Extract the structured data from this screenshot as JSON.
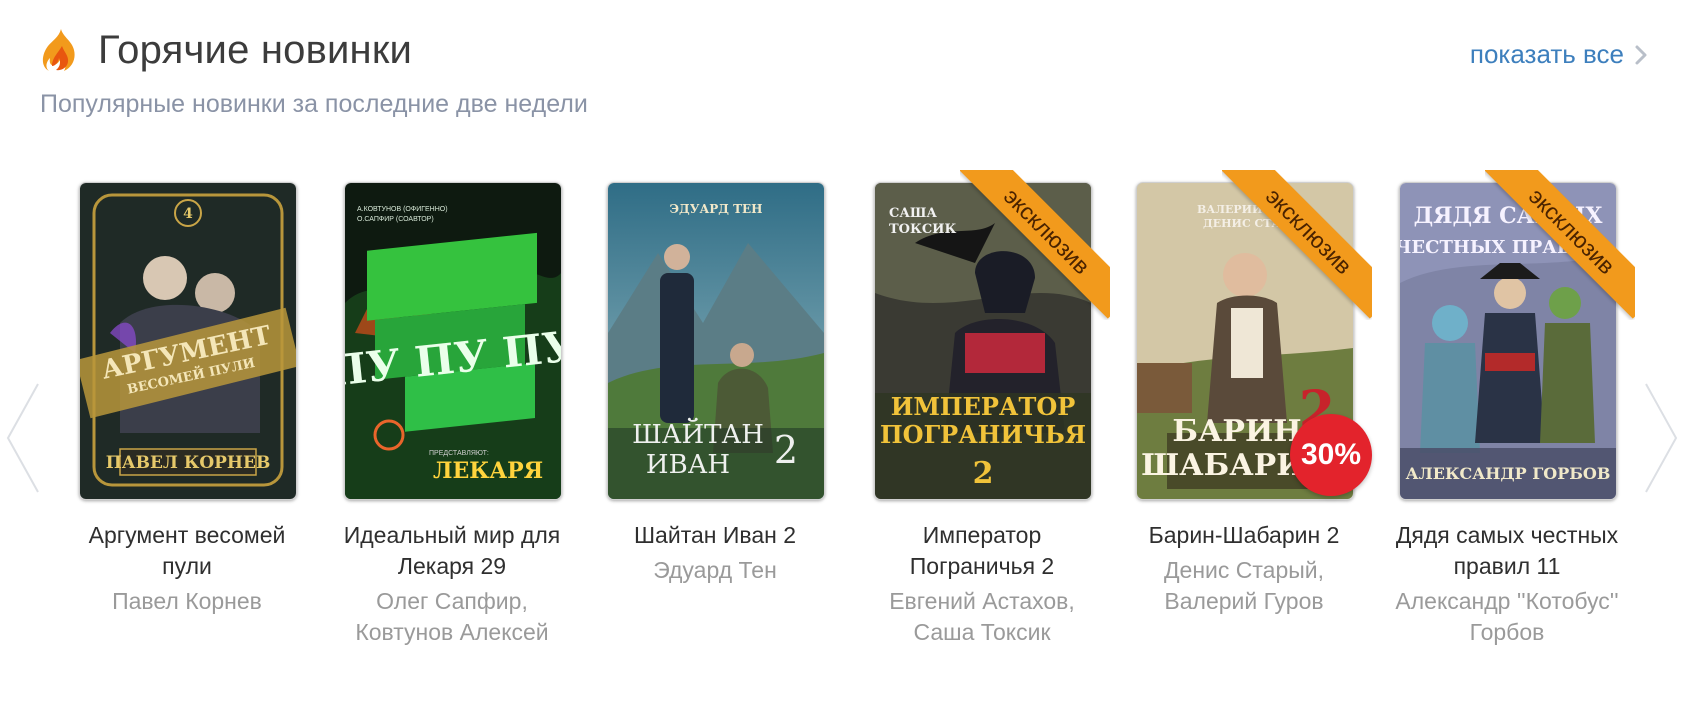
{
  "header": {
    "title": "Горячие новинки",
    "subtitle": "Популярные новинки за последние две недели",
    "show_all_label": "показать все",
    "icon": "fire-icon",
    "accent_color": "#3d7fbd"
  },
  "carousel": {
    "prev_icon": "chevron-left-icon",
    "next_icon": "chevron-right-icon"
  },
  "books": [
    {
      "title": "Аргумент весомей пули",
      "authors": "Павел Корнев",
      "cover_text": [
        "4",
        "АРГУМЕНТ",
        "ВЕСОМЕЙ ПУЛИ",
        "ПАВЕЛ КОРНЕВ"
      ],
      "exclusive": false,
      "discount": null
    },
    {
      "title": "Идеальный мир для Лекаря 29",
      "authors": "Олег Сапфир, Ковтунов Алексей",
      "cover_text": [
        "А.КОВТУНОВ (ОФИГЕННО)",
        "О.САПФИР (СОАВТОР)",
        "ПУ ПУ ПУ",
        "ПРЕДСТАВЛЯЮТ:",
        "ЛЕКАРЯ"
      ],
      "exclusive": false,
      "discount": null
    },
    {
      "title": "Шайтан Иван 2",
      "authors": "Эдуард Тен",
      "cover_text": [
        "ЭДУАРД ТЕН",
        "ШАЙТАН",
        "ИВАН",
        "2"
      ],
      "exclusive": false,
      "discount": null
    },
    {
      "title": "Император Пограничья 2",
      "authors": "Евгений Астахов, Саша Токсик",
      "cover_text": [
        "САША",
        "ТОКСИК",
        "ИМПЕРАТОР",
        "ПОГРАНИЧЬЯ",
        "2"
      ],
      "exclusive": true,
      "exclusive_label": "эксклюзив",
      "discount": null
    },
    {
      "title": "Барин-Шабарин 2",
      "authors": "Денис Старый, Валерий Гуров",
      "cover_text": [
        "ВАЛЕРИЙ ГУРОВ",
        "ДЕНИС СТАРЫЙ",
        "БАРИН",
        "ШАБАРИН",
        "2"
      ],
      "exclusive": true,
      "exclusive_label": "эксклюзив",
      "discount": "30%"
    },
    {
      "title": "Дядя самых честных правил 11",
      "authors": "Александр ''Котобус'' Горбов",
      "cover_text": [
        "ДЯДЯ САМЫХ",
        "ЧЕСТНЫХ ПРАВИЛ",
        "АЛЕКСАНДР ГОРБОВ"
      ],
      "exclusive": true,
      "exclusive_label": "эксклюзив",
      "discount": null
    }
  ]
}
